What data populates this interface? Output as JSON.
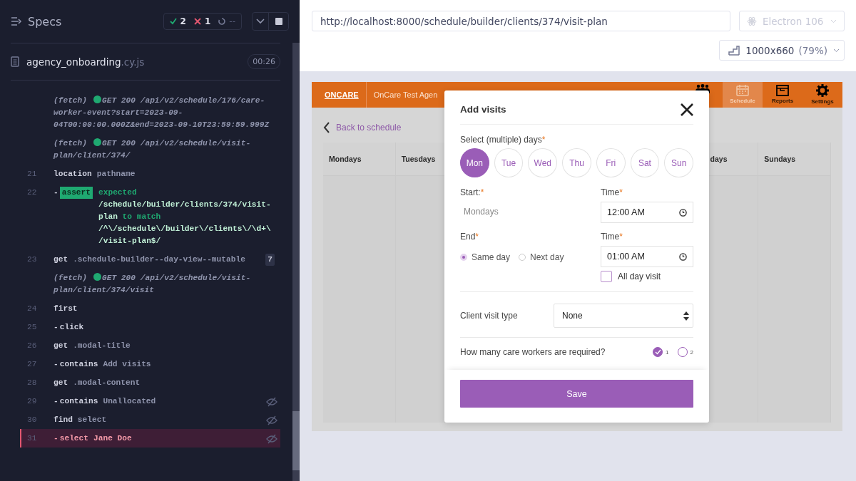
{
  "runner": {
    "title": "Specs",
    "passed": "2",
    "failed": "1",
    "pending": "--",
    "spec": {
      "name": "agency_onboarding",
      "ext": ".cy.js",
      "duration": "00:26"
    },
    "commands": [
      {
        "kind": "fetch",
        "prefix": "(fetch)",
        "message": "GET 200 /api/v2/schedule/176/care-worker-event?start=2023-09-04T00:00:00.000Z&end=2023-09-10T23:59:59.999Z"
      },
      {
        "kind": "fetch",
        "prefix": "(fetch)",
        "message": "GET 200 /api/v2/schedule/visit-plan/client/374/"
      },
      {
        "kind": "command",
        "number": "21",
        "name": "location",
        "message": "pathname",
        "hidden": false,
        "failed": false
      },
      {
        "kind": "assert",
        "number": "22",
        "dash": "-",
        "name": "assert",
        "message": "expected **/schedule/builder/clients/374/visit-plan** to match **/^\\/schedule\\/builder\\/clients\\/\\d+\\/visit-plan$/**",
        "hidden": false,
        "failed": false
      },
      {
        "kind": "command",
        "number": "23",
        "name": "get",
        "message": ".schedule-builder--day-view--mutable",
        "badge": "7",
        "hidden": false,
        "failed": false
      },
      {
        "kind": "fetch",
        "prefix": "(fetch)",
        "message": "GET 200 /api/v2/schedule/visit-plan/client/374/visit"
      },
      {
        "kind": "command",
        "number": "24",
        "name": "first",
        "hidden": false,
        "failed": false
      },
      {
        "kind": "command",
        "number": "25",
        "dash": "-",
        "name": "click",
        "hidden": false,
        "failed": false
      },
      {
        "kind": "command",
        "number": "26",
        "name": "get",
        "message": ".modal-title",
        "hidden": false,
        "failed": false
      },
      {
        "kind": "command",
        "number": "27",
        "dash": "-",
        "name": "contains",
        "message": "Add visits",
        "hidden": false,
        "failed": false
      },
      {
        "kind": "command",
        "number": "28",
        "name": "get",
        "message": ".modal-content",
        "hidden": false,
        "failed": false
      },
      {
        "kind": "command",
        "number": "29",
        "dash": "-",
        "name": "contains",
        "message": "Unallocated",
        "hidden": true,
        "failed": false
      },
      {
        "kind": "command",
        "number": "30",
        "name": "find",
        "message": "select",
        "hidden": true,
        "failed": false
      },
      {
        "kind": "command",
        "number": "31",
        "dash": "-",
        "name": "select",
        "message": "Jane Doe",
        "hidden": true,
        "failed": true
      }
    ]
  },
  "browser": {
    "url": "http://localhost:8000/schedule/builder/clients/374/visit-plan",
    "engine": "Electron 106",
    "viewport": "1000x660",
    "zoom": "(79%)"
  },
  "app": {
    "logo": "ONCARE",
    "agency": "OnCare Test Agen",
    "nav": [
      {
        "selected": false
      },
      {
        "label": "Schedule",
        "selected": true
      },
      {
        "label": "Reports",
        "selected": false
      },
      {
        "label": "Settings",
        "selected": false
      }
    ],
    "back_link": "Back to schedule",
    "columns": [
      {
        "label": "Mondays"
      },
      {
        "label": "Tuesdays"
      },
      {},
      {},
      {},
      {
        "label": "days",
        "cut": true
      },
      {
        "label": "Sundays"
      }
    ]
  },
  "modal": {
    "title": "Add visits",
    "days_label": "Select (multiple) days",
    "required_mark": "*",
    "days": [
      {
        "label": "Mon",
        "selected": true
      },
      {
        "label": "Tue",
        "selected": false
      },
      {
        "label": "Wed",
        "selected": false
      },
      {
        "label": "Thu",
        "selected": false
      },
      {
        "label": "Fri",
        "selected": false
      },
      {
        "label": "Sat",
        "selected": false
      },
      {
        "label": "Sun",
        "selected": false
      }
    ],
    "start_label": "Start:",
    "start_value": "Mondays",
    "start_time_label": "Time",
    "start_time": "12:00 AM",
    "end_label": "End",
    "end_options": [
      {
        "label": "Same day",
        "selected": true
      },
      {
        "label": "Next day",
        "selected": false
      }
    ],
    "end_time_label": "Time",
    "end_time": "01:00 AM",
    "all_day": {
      "label": "All day visit",
      "checked": false
    },
    "visit_type_label": "Client visit type",
    "visit_type": "None",
    "workers_label": "How many care workers are required?",
    "workers": [
      {
        "label": "1",
        "selected": true
      },
      {
        "label": "2",
        "selected": false
      }
    ],
    "save": "Save"
  }
}
